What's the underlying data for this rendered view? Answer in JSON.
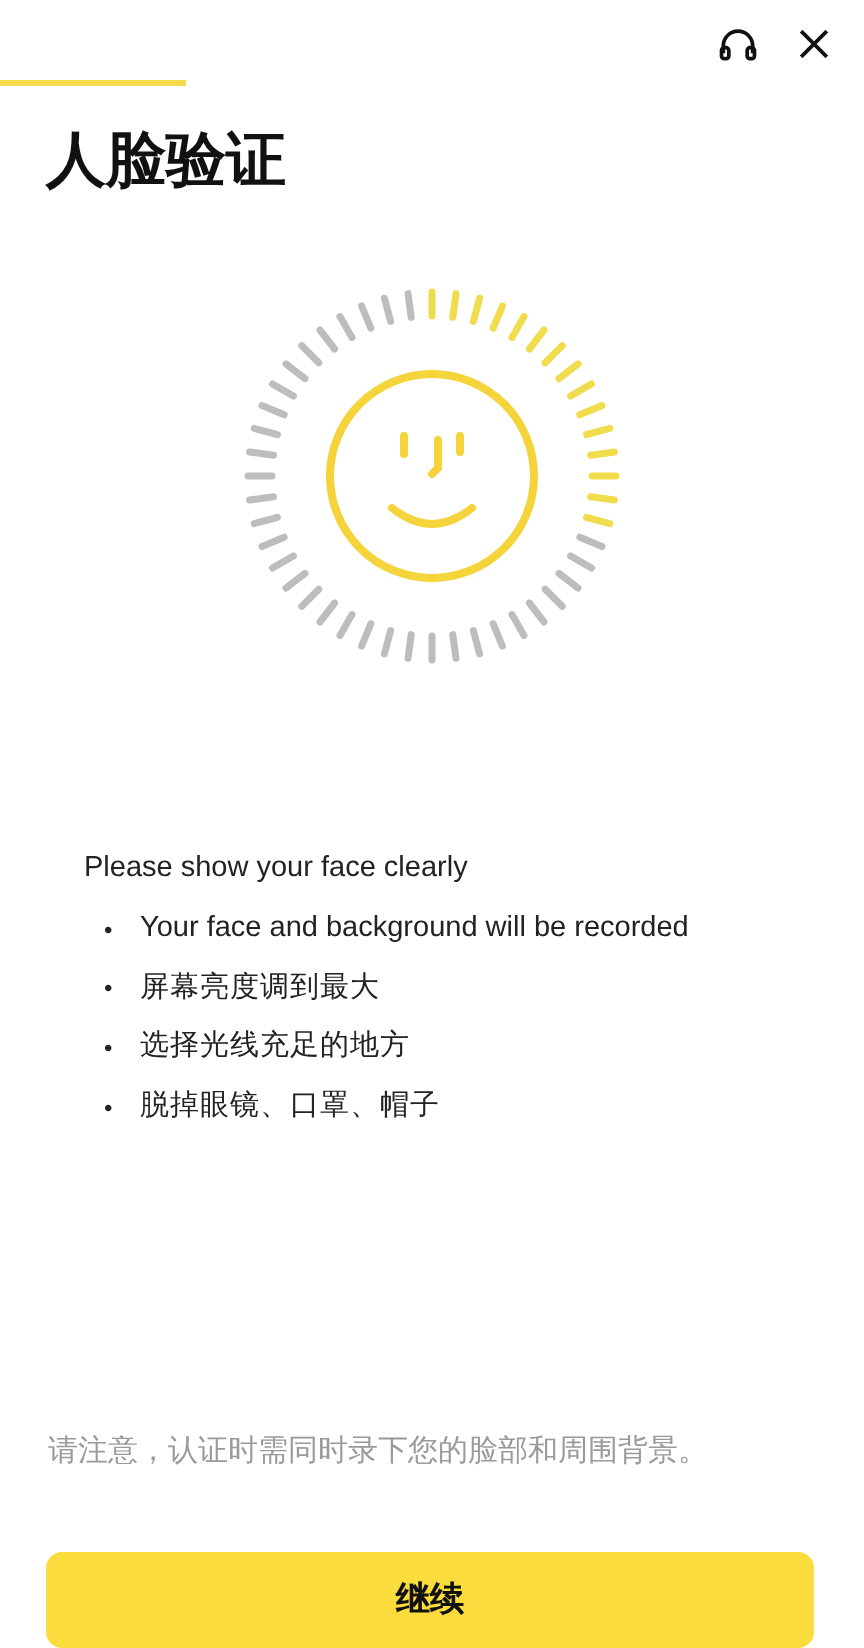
{
  "header": {
    "title": "人脸验证"
  },
  "instructions": {
    "heading": "Please show your face clearly",
    "bullets": [
      {
        "marker": "•",
        "text": "Your face and background will be recorded"
      },
      {
        "marker": "•",
        "text": "屏幕亮度调到最大"
      },
      {
        "marker": "•",
        "text": "选择光线充足的地方"
      },
      {
        "marker": "•",
        "text": "脱掉眼镜、口罩、帽子"
      }
    ]
  },
  "notice": "请注意，认证时需同时录下您的脸部和周围背景。",
  "button": "继续"
}
